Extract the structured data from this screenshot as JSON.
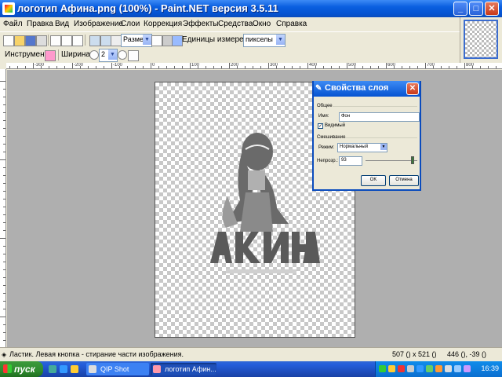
{
  "window": {
    "title": "логотип Афина.png (100%) - Paint.NET версия 3.5.11",
    "minimize": "_",
    "maximize": "□",
    "close": "✕"
  },
  "menu": [
    "Файл",
    "Правка",
    "Вид",
    "Изображение",
    "Слои",
    "Коррекция",
    "Эффекты",
    "Средства",
    "Окно",
    "Справка"
  ],
  "toolbar": {
    "size_combo": "Размер",
    "units_label": "Единицы измерения:",
    "units_value": "пикселы"
  },
  "toolbar2": {
    "tool_label": "Инструмент:",
    "width_label": "Ширина:",
    "width_value": "2"
  },
  "rulers": {
    "h_labels": [
      "-300",
      "-200",
      "-100",
      "0",
      "100",
      "200",
      "300",
      "400",
      "500",
      "600",
      "700",
      "800"
    ],
    "v_labels": [
      "0",
      "100",
      "200",
      "300"
    ]
  },
  "dialog": {
    "title": "Свойства слоя",
    "close": "✕",
    "group_general": "Общее",
    "name_label": "Имя:",
    "name_value": "Фон",
    "visible_label": "Видимый",
    "visible_checked": true,
    "group_blend": "Смешивание",
    "mode_label": "Режим:",
    "mode_value": "Нормальный",
    "opacity_label": "Непрозр.:",
    "opacity_value": "93",
    "ok": "OK",
    "cancel": "Отмена"
  },
  "status": {
    "text": "Ластик. Левая кнопка - стирание части изображения.",
    "size": "507 () x 521 ()",
    "coords": "446 (), -39 ()"
  },
  "taskbar": {
    "start": "пуск",
    "tasks": [
      "QIP Shot",
      "логотип Афин..."
    ],
    "clock": "16:39"
  },
  "colors": {
    "titlebar": "#0553d1",
    "workspace": "#afafaf",
    "taskbar": "#245edb",
    "start": "#2e8b2e"
  }
}
